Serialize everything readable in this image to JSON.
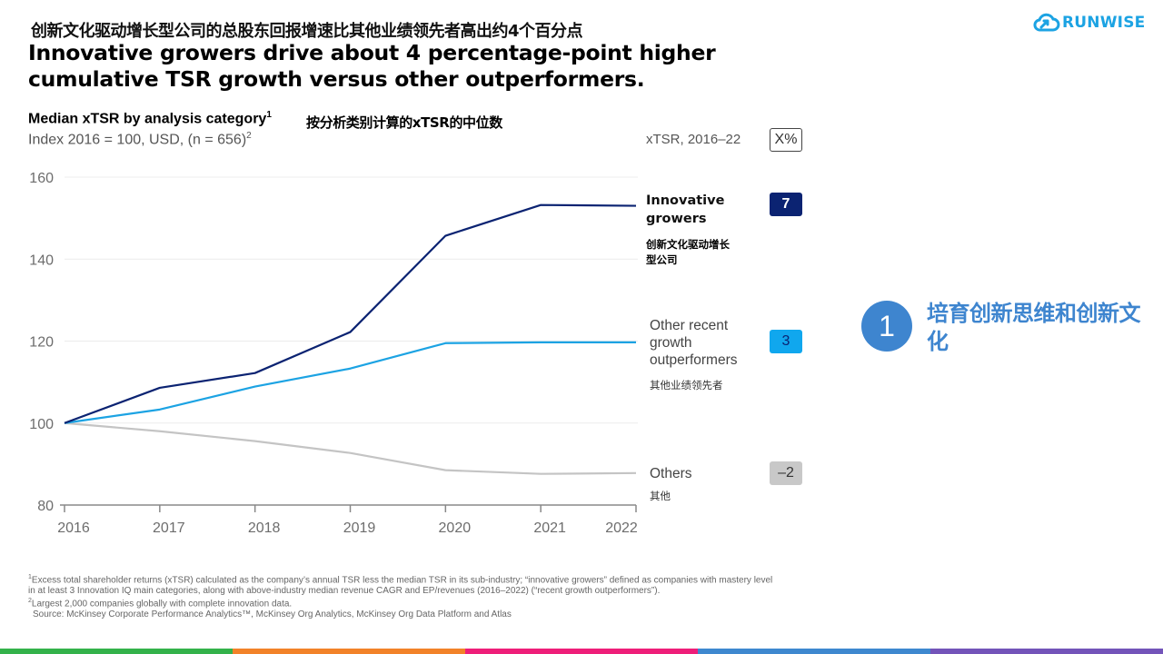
{
  "header": {
    "title_zh": "创新文化驱动增长型公司的总股东回报增速比其他业绩领先者高出约4个百分点",
    "title_en": "Innovative growers drive about 4 percentage-point higher cumulative TSR growth versus other outperformers.",
    "logo_text": "RUNWISE",
    "logo_icon": "cloud-arrow-icon"
  },
  "chart_header": {
    "subtitle": "Median xTSR by analysis category",
    "subtitle_sup": "1",
    "subtitle_zh": "按分析类别计算的xTSR的中位数",
    "index_note": "Index 2016 = 100, USD, (n = 656)",
    "index_note_sup": "2"
  },
  "legend_panel": {
    "heading": "xTSR, 2016–22",
    "heading_badge": "X%",
    "items": [
      {
        "label": "Innovative growers",
        "label_zh": "创新文化驱动增长型公司",
        "value": "7",
        "color": "#0b2372"
      },
      {
        "label": "Other recent growth outperformers",
        "label_zh": "其他业绩领先者",
        "value": "3",
        "color": "#10a7ee"
      },
      {
        "label": "Others",
        "label_zh": "其他",
        "value": "–2",
        "color": "#c8c8c8"
      }
    ]
  },
  "chart_data": {
    "type": "line",
    "title": "Median xTSR by analysis category",
    "subtitle": "Index 2016 = 100, USD, (n = 656)",
    "xlabel": "",
    "ylabel": "",
    "x": [
      "2016",
      "2017",
      "2018",
      "2019",
      "2020",
      "2021",
      "2022"
    ],
    "ylim": [
      80,
      160
    ],
    "yticks": [
      80,
      100,
      120,
      140,
      160
    ],
    "grid": true,
    "series": [
      {
        "name": "Innovative growers",
        "color": "#0b2372",
        "values": [
          100,
          108.6,
          112.2,
          122.2,
          145.7,
          153.2,
          153.0
        ]
      },
      {
        "name": "Other recent growth outperformers",
        "color": "#1ca3e3",
        "values": [
          100,
          103.3,
          108.9,
          113.3,
          119.5,
          119.7,
          119.7
        ]
      },
      {
        "name": "Others",
        "color": "#c4c4c4",
        "values": [
          100,
          98.0,
          95.6,
          92.7,
          88.5,
          87.6,
          87.8
        ]
      }
    ]
  },
  "callout": {
    "number": "1",
    "text": "培育创新思维和创新文化",
    "color": "#3e85cf"
  },
  "footnotes": {
    "note1_sup": "1",
    "note1": "Excess total shareholder returns (xTSR) calculated as the company’s annual TSR less the median TSR in its sub-industry; “innovative growers” defined as companies with mastery level in at least 3 Innovation IQ main categories, along with above-industry median revenue CAGR and EP/revenues (2016–2022) (“recent growth outperformers”).",
    "note2_sup": "2",
    "note2": "Largest 2,000 companies globally with complete innovation data.",
    "source": "Source: McKinsey Corporate Performance Analytics™, McKinsey Org Analytics, McKinsey Org Data Platform and Atlas"
  },
  "bottom_bar_colors": [
    "#33b24a",
    "#f28229",
    "#ee1e79",
    "#3e88cf",
    "#7354b9"
  ]
}
